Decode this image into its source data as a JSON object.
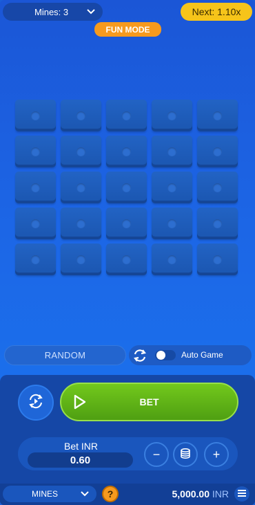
{
  "top": {
    "mines_label": "Mines: 3",
    "next_label": "Next: 1.10x",
    "fun_mode_label": "FUN MODE"
  },
  "grid": {
    "rows": 5,
    "cols": 5
  },
  "controls": {
    "random_label": "RANDOM",
    "auto_game_label": "Auto Game",
    "auto_game_on": false,
    "bet_button_label": "BET"
  },
  "bet": {
    "label": "Bet INR",
    "value": "0.60",
    "minus": "−",
    "plus": "+"
  },
  "footer": {
    "game_label": "MINES",
    "help_label": "?",
    "balance_amount": "5,000.00",
    "balance_currency": "INR"
  },
  "colors": {
    "accent_yellow": "#f6c41a",
    "fun_mode_orange": "#f69a1e",
    "bet_green": "#5fb319",
    "background_blue": "#1c66e6"
  }
}
